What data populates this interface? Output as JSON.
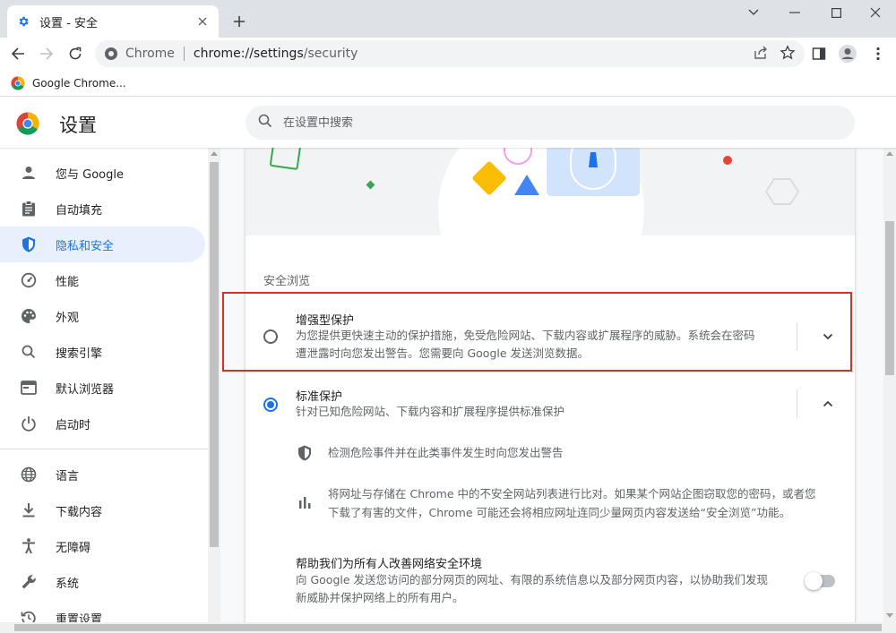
{
  "tab": {
    "title": "设置 - 安全",
    "icon": "gear-icon"
  },
  "toolbar": {
    "site_chip": "Chrome",
    "url_host": "chrome://settings",
    "url_path": "/security"
  },
  "bookmarks": [
    {
      "label": "Google Chrome..."
    }
  ],
  "header": {
    "title": "设置",
    "search_placeholder": "在设置中搜索"
  },
  "sidebar": {
    "items": [
      {
        "label": "您与 Google",
        "icon": "person-icon"
      },
      {
        "label": "自动填充",
        "icon": "clipboard-icon"
      },
      {
        "label": "隐私和安全",
        "icon": "shield-icon",
        "active": true
      },
      {
        "label": "性能",
        "icon": "speedometer-icon"
      },
      {
        "label": "外观",
        "icon": "palette-icon"
      },
      {
        "label": "搜索引擎",
        "icon": "search-icon"
      },
      {
        "label": "默认浏览器",
        "icon": "browser-icon"
      },
      {
        "label": "启动时",
        "icon": "power-icon"
      },
      {
        "label": "语言",
        "icon": "globe-icon"
      },
      {
        "label": "下载内容",
        "icon": "download-icon"
      },
      {
        "label": "无障碍",
        "icon": "accessibility-icon"
      },
      {
        "label": "系统",
        "icon": "wrench-icon"
      },
      {
        "label": "重置设置",
        "icon": "reset-icon"
      }
    ]
  },
  "safe_browsing": {
    "section_label": "安全浏览",
    "enhanced": {
      "title": "增强型保护",
      "desc_line1": "为您提供更快速主动的保护措施，免受危险网站、下载内容或扩展程序的威胁。系统会在密码",
      "desc_line2": "遭泄露时向您发出警告。您需要向 Google 发送浏览数据。",
      "checked": false
    },
    "standard": {
      "title": "标准保护",
      "desc": "针对已知危险网站、下载内容和扩展程序提供标准保护",
      "checked": true,
      "detail1": "检测危险事件并在此类事件发生时向您发出警告",
      "detail2_line1": "将网址与存储在 Chrome 中的不安全网站列表进行比对。如果某个网站企图窃取您的密码，或者您",
      "detail2_line2": "下载了有害的文件，Chrome 可能还会将相应网址连同少量网页内容发送给“安全浏览”功能。"
    },
    "improve": {
      "title": "帮助我们为所有人改善网络安全环境",
      "desc_line1": "向 Google 发送您访问的部分网页的网址、有限的系统信息以及部分网页内容，以协助我们发现",
      "desc_line2": "新威胁并保护网络上的所有用户。",
      "enabled": false
    }
  },
  "colors": {
    "accent": "#1a73e8",
    "highlight": "#d93025",
    "active_nav_bg": "#e8f0fe"
  }
}
